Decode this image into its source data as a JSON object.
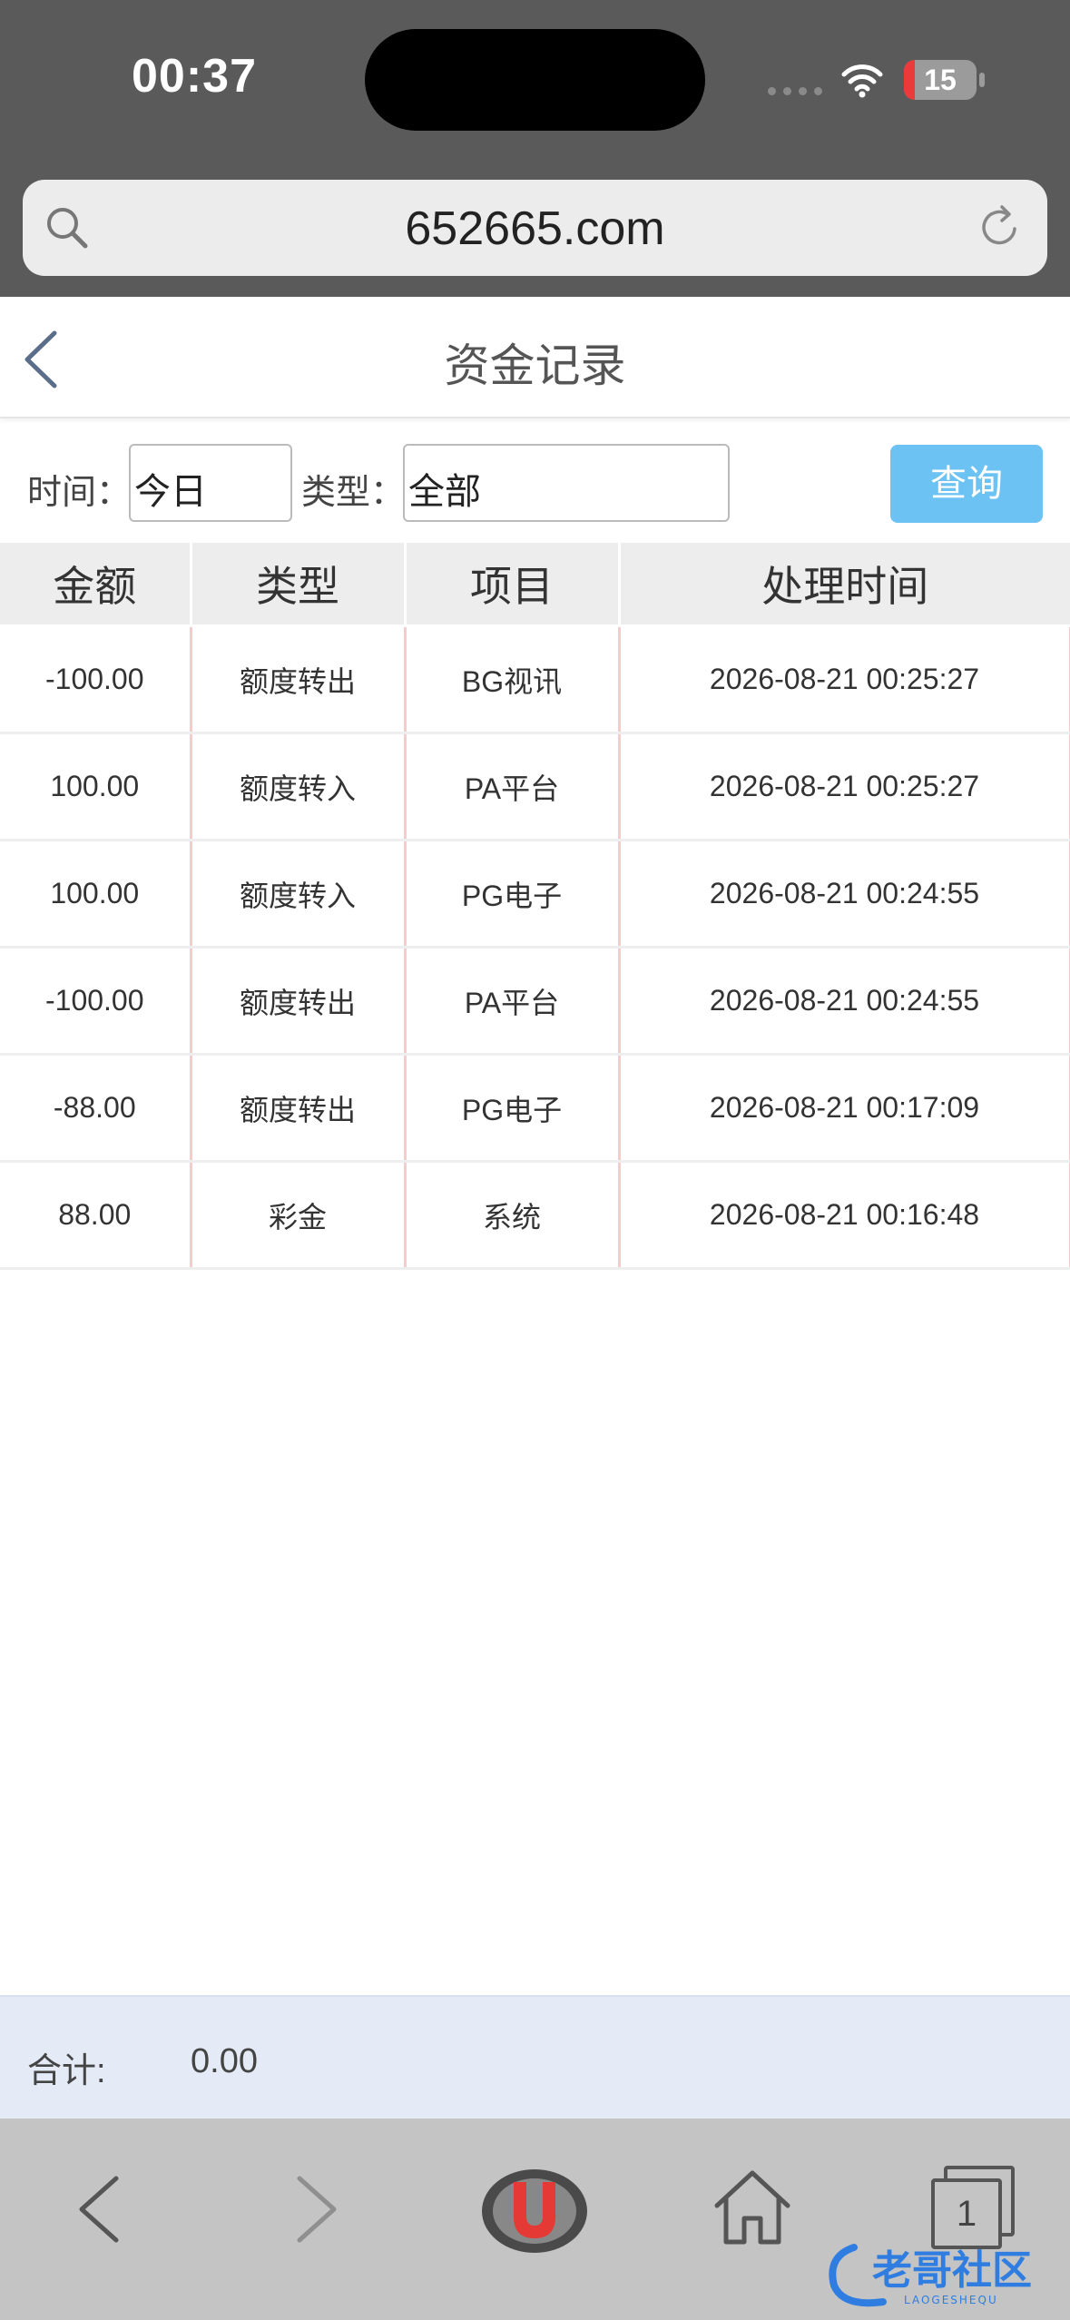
{
  "status_bar": {
    "time": "00:37",
    "battery": "15",
    "battery_level": 0.15
  },
  "browser": {
    "url": "652665.com"
  },
  "header": {
    "title": "资金记录"
  },
  "filters": {
    "time_label": "时间：",
    "time_value": "今日",
    "type_label": "类型：",
    "type_value": "全部",
    "query_label": "查询"
  },
  "table": {
    "columns": [
      "金额",
      "类型",
      "项目",
      "处理时间"
    ],
    "rows": [
      [
        "-100.00",
        "额度转出",
        "BG视讯",
        "2026-08-21 00:25:27"
      ],
      [
        "100.00",
        "额度转入",
        "PA平台",
        "2026-08-21 00:25:27"
      ],
      [
        "100.00",
        "额度转入",
        "PG电子",
        "2026-08-21 00:24:55"
      ],
      [
        "-100.00",
        "额度转出",
        "PA平台",
        "2026-08-21 00:24:55"
      ],
      [
        "-88.00",
        "额度转出",
        "PG电子",
        "2026-08-21 00:17:09"
      ],
      [
        "88.00",
        "彩金",
        "系统",
        "2026-08-21 00:16:48"
      ]
    ]
  },
  "footer": {
    "total_label": "合计:",
    "total_value": "0.00"
  },
  "toolbar": {
    "tabs_count": "1"
  },
  "watermark": {
    "text": "老哥社区",
    "subtext": "LAOGESHEQU"
  },
  "colors": {
    "accent": "#6cc3f3",
    "footer_bg": "#e4ebf6",
    "table_divider": "#f5cccc",
    "logo_red": "#e53935"
  }
}
